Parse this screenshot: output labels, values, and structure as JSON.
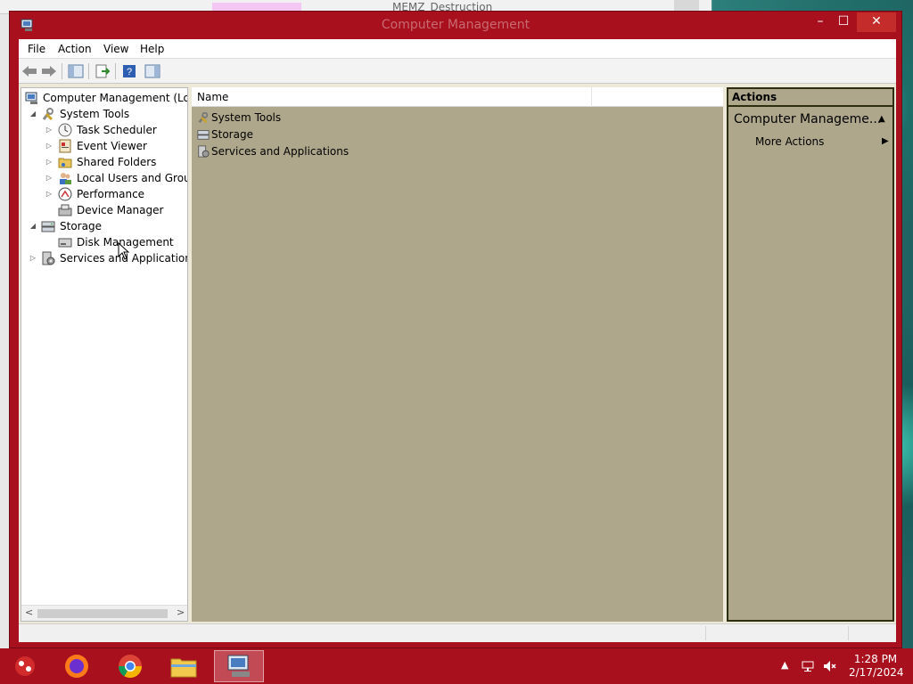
{
  "background_window": {
    "title": "MEMZ_Destruction"
  },
  "window": {
    "title": "Computer Management",
    "controls": {
      "minimize": "–",
      "maximize": "☐",
      "close": "✕"
    }
  },
  "menu": {
    "items": [
      {
        "label": "File"
      },
      {
        "label": "Action"
      },
      {
        "label": "View"
      },
      {
        "label": "Help"
      }
    ]
  },
  "toolbar": {
    "buttons": [
      "back-icon",
      "forward-icon",
      "show-hide-console-tree-icon",
      "export-list-icon",
      "help-icon",
      "show-hide-action-pane-icon"
    ]
  },
  "tree": {
    "root": {
      "label": "Computer Management (Local"
    },
    "items": [
      {
        "label": "System Tools",
        "icon": "tools-icon",
        "expanded": true
      },
      {
        "label": "Task Scheduler",
        "icon": "clock-icon"
      },
      {
        "label": "Event Viewer",
        "icon": "event-viewer-icon"
      },
      {
        "label": "Shared Folders",
        "icon": "shared-folder-icon"
      },
      {
        "label": "Local Users and Groups",
        "icon": "users-icon"
      },
      {
        "label": "Performance",
        "icon": "performance-icon"
      },
      {
        "label": "Device Manager",
        "icon": "device-manager-icon"
      },
      {
        "label": "Storage",
        "icon": "storage-icon",
        "expanded": true
      },
      {
        "label": "Disk Management",
        "icon": "disk-icon"
      },
      {
        "label": "Services and Applications",
        "icon": "services-icon"
      }
    ]
  },
  "list": {
    "column_header": "Name",
    "rows": [
      {
        "label": "System Tools",
        "icon": "tools-icon"
      },
      {
        "label": "Storage",
        "icon": "storage-icon"
      },
      {
        "label": "Services and Applications",
        "icon": "services-icon"
      }
    ]
  },
  "actions": {
    "header": "Actions",
    "section": "Computer Manageme...",
    "more_actions": "More Actions"
  },
  "taskbar": {
    "apps": [
      "memz-icon",
      "firefox-icon",
      "chrome-icon",
      "file-explorer-icon",
      "computer-management-icon"
    ],
    "clock": {
      "time": "1:28 PM",
      "date": "2/17/2024"
    }
  },
  "colors": {
    "window_frame": "#a8101e",
    "content_pane": "#aea78b",
    "actions_border": "#2d2d10"
  }
}
